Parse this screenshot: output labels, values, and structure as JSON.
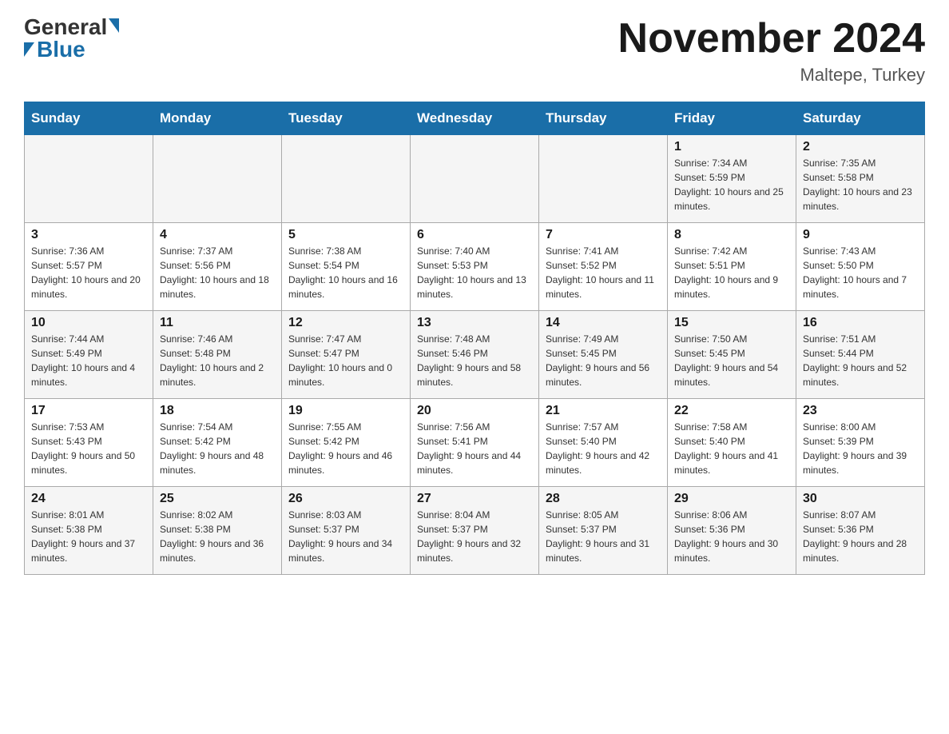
{
  "header": {
    "logo_general": "General",
    "logo_blue": "Blue",
    "month_title": "November 2024",
    "location": "Maltepe, Turkey"
  },
  "days_of_week": [
    "Sunday",
    "Monday",
    "Tuesday",
    "Wednesday",
    "Thursday",
    "Friday",
    "Saturday"
  ],
  "weeks": [
    {
      "days": [
        {
          "num": "",
          "sunrise": "",
          "sunset": "",
          "daylight": ""
        },
        {
          "num": "",
          "sunrise": "",
          "sunset": "",
          "daylight": ""
        },
        {
          "num": "",
          "sunrise": "",
          "sunset": "",
          "daylight": ""
        },
        {
          "num": "",
          "sunrise": "",
          "sunset": "",
          "daylight": ""
        },
        {
          "num": "",
          "sunrise": "",
          "sunset": "",
          "daylight": ""
        },
        {
          "num": "1",
          "sunrise": "Sunrise: 7:34 AM",
          "sunset": "Sunset: 5:59 PM",
          "daylight": "Daylight: 10 hours and 25 minutes."
        },
        {
          "num": "2",
          "sunrise": "Sunrise: 7:35 AM",
          "sunset": "Sunset: 5:58 PM",
          "daylight": "Daylight: 10 hours and 23 minutes."
        }
      ]
    },
    {
      "days": [
        {
          "num": "3",
          "sunrise": "Sunrise: 7:36 AM",
          "sunset": "Sunset: 5:57 PM",
          "daylight": "Daylight: 10 hours and 20 minutes."
        },
        {
          "num": "4",
          "sunrise": "Sunrise: 7:37 AM",
          "sunset": "Sunset: 5:56 PM",
          "daylight": "Daylight: 10 hours and 18 minutes."
        },
        {
          "num": "5",
          "sunrise": "Sunrise: 7:38 AM",
          "sunset": "Sunset: 5:54 PM",
          "daylight": "Daylight: 10 hours and 16 minutes."
        },
        {
          "num": "6",
          "sunrise": "Sunrise: 7:40 AM",
          "sunset": "Sunset: 5:53 PM",
          "daylight": "Daylight: 10 hours and 13 minutes."
        },
        {
          "num": "7",
          "sunrise": "Sunrise: 7:41 AM",
          "sunset": "Sunset: 5:52 PM",
          "daylight": "Daylight: 10 hours and 11 minutes."
        },
        {
          "num": "8",
          "sunrise": "Sunrise: 7:42 AM",
          "sunset": "Sunset: 5:51 PM",
          "daylight": "Daylight: 10 hours and 9 minutes."
        },
        {
          "num": "9",
          "sunrise": "Sunrise: 7:43 AM",
          "sunset": "Sunset: 5:50 PM",
          "daylight": "Daylight: 10 hours and 7 minutes."
        }
      ]
    },
    {
      "days": [
        {
          "num": "10",
          "sunrise": "Sunrise: 7:44 AM",
          "sunset": "Sunset: 5:49 PM",
          "daylight": "Daylight: 10 hours and 4 minutes."
        },
        {
          "num": "11",
          "sunrise": "Sunrise: 7:46 AM",
          "sunset": "Sunset: 5:48 PM",
          "daylight": "Daylight: 10 hours and 2 minutes."
        },
        {
          "num": "12",
          "sunrise": "Sunrise: 7:47 AM",
          "sunset": "Sunset: 5:47 PM",
          "daylight": "Daylight: 10 hours and 0 minutes."
        },
        {
          "num": "13",
          "sunrise": "Sunrise: 7:48 AM",
          "sunset": "Sunset: 5:46 PM",
          "daylight": "Daylight: 9 hours and 58 minutes."
        },
        {
          "num": "14",
          "sunrise": "Sunrise: 7:49 AM",
          "sunset": "Sunset: 5:45 PM",
          "daylight": "Daylight: 9 hours and 56 minutes."
        },
        {
          "num": "15",
          "sunrise": "Sunrise: 7:50 AM",
          "sunset": "Sunset: 5:45 PM",
          "daylight": "Daylight: 9 hours and 54 minutes."
        },
        {
          "num": "16",
          "sunrise": "Sunrise: 7:51 AM",
          "sunset": "Sunset: 5:44 PM",
          "daylight": "Daylight: 9 hours and 52 minutes."
        }
      ]
    },
    {
      "days": [
        {
          "num": "17",
          "sunrise": "Sunrise: 7:53 AM",
          "sunset": "Sunset: 5:43 PM",
          "daylight": "Daylight: 9 hours and 50 minutes."
        },
        {
          "num": "18",
          "sunrise": "Sunrise: 7:54 AM",
          "sunset": "Sunset: 5:42 PM",
          "daylight": "Daylight: 9 hours and 48 minutes."
        },
        {
          "num": "19",
          "sunrise": "Sunrise: 7:55 AM",
          "sunset": "Sunset: 5:42 PM",
          "daylight": "Daylight: 9 hours and 46 minutes."
        },
        {
          "num": "20",
          "sunrise": "Sunrise: 7:56 AM",
          "sunset": "Sunset: 5:41 PM",
          "daylight": "Daylight: 9 hours and 44 minutes."
        },
        {
          "num": "21",
          "sunrise": "Sunrise: 7:57 AM",
          "sunset": "Sunset: 5:40 PM",
          "daylight": "Daylight: 9 hours and 42 minutes."
        },
        {
          "num": "22",
          "sunrise": "Sunrise: 7:58 AM",
          "sunset": "Sunset: 5:40 PM",
          "daylight": "Daylight: 9 hours and 41 minutes."
        },
        {
          "num": "23",
          "sunrise": "Sunrise: 8:00 AM",
          "sunset": "Sunset: 5:39 PM",
          "daylight": "Daylight: 9 hours and 39 minutes."
        }
      ]
    },
    {
      "days": [
        {
          "num": "24",
          "sunrise": "Sunrise: 8:01 AM",
          "sunset": "Sunset: 5:38 PM",
          "daylight": "Daylight: 9 hours and 37 minutes."
        },
        {
          "num": "25",
          "sunrise": "Sunrise: 8:02 AM",
          "sunset": "Sunset: 5:38 PM",
          "daylight": "Daylight: 9 hours and 36 minutes."
        },
        {
          "num": "26",
          "sunrise": "Sunrise: 8:03 AM",
          "sunset": "Sunset: 5:37 PM",
          "daylight": "Daylight: 9 hours and 34 minutes."
        },
        {
          "num": "27",
          "sunrise": "Sunrise: 8:04 AM",
          "sunset": "Sunset: 5:37 PM",
          "daylight": "Daylight: 9 hours and 32 minutes."
        },
        {
          "num": "28",
          "sunrise": "Sunrise: 8:05 AM",
          "sunset": "Sunset: 5:37 PM",
          "daylight": "Daylight: 9 hours and 31 minutes."
        },
        {
          "num": "29",
          "sunrise": "Sunrise: 8:06 AM",
          "sunset": "Sunset: 5:36 PM",
          "daylight": "Daylight: 9 hours and 30 minutes."
        },
        {
          "num": "30",
          "sunrise": "Sunrise: 8:07 AM",
          "sunset": "Sunset: 5:36 PM",
          "daylight": "Daylight: 9 hours and 28 minutes."
        }
      ]
    }
  ]
}
